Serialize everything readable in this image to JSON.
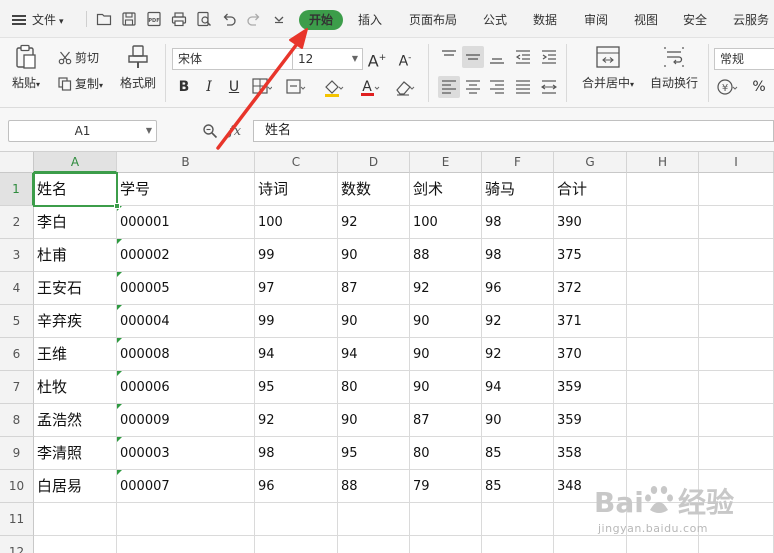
{
  "menubar": {
    "file_label": "文件",
    "tabs": [
      "开始",
      "插入",
      "页面布局",
      "公式",
      "数据",
      "审阅",
      "视图",
      "安全",
      "云服务"
    ],
    "active_tab": "开始"
  },
  "ribbon": {
    "paste": "粘贴",
    "cut": "剪切",
    "copy": "复制",
    "format_painter": "格式刷",
    "font_name": "宋体",
    "font_size": "12",
    "merge_center": "合并居中",
    "wrap_text": "自动换行",
    "number_format": "常规",
    "percent": "%"
  },
  "formula_bar": {
    "name_box": "A1",
    "fx": "fx",
    "content": "姓名"
  },
  "grid": {
    "columns": [
      "A",
      "B",
      "C",
      "D",
      "E",
      "F",
      "G",
      "H",
      "I"
    ],
    "rows": [
      "1",
      "2",
      "3",
      "4",
      "5",
      "6",
      "7",
      "8",
      "9",
      "10",
      "11",
      "12"
    ],
    "data": [
      [
        "姓名",
        "学号",
        "诗词",
        "数数",
        "剑术",
        "骑马",
        "合计"
      ],
      [
        "李白",
        "000001",
        "100",
        "92",
        "100",
        "98",
        "390"
      ],
      [
        "杜甫",
        "000002",
        "99",
        "90",
        "88",
        "98",
        "375"
      ],
      [
        "王安石",
        "000005",
        "97",
        "87",
        "92",
        "96",
        "372"
      ],
      [
        "辛弃疾",
        "000004",
        "99",
        "90",
        "90",
        "92",
        "371"
      ],
      [
        "王维",
        "000008",
        "94",
        "94",
        "90",
        "92",
        "370"
      ],
      [
        "杜牧",
        "000006",
        "95",
        "80",
        "90",
        "94",
        "359"
      ],
      [
        "孟浩然",
        "000009",
        "92",
        "90",
        "87",
        "90",
        "359"
      ],
      [
        "李清照",
        "000003",
        "98",
        "95",
        "80",
        "85",
        "358"
      ],
      [
        "白居易",
        "000007",
        "96",
        "88",
        "79",
        "85",
        "348"
      ]
    ]
  },
  "watermark": {
    "text": "jingyan.baidu.com"
  },
  "colors": {
    "accent": "#3c9d4a",
    "arrow": "#e8352b"
  }
}
